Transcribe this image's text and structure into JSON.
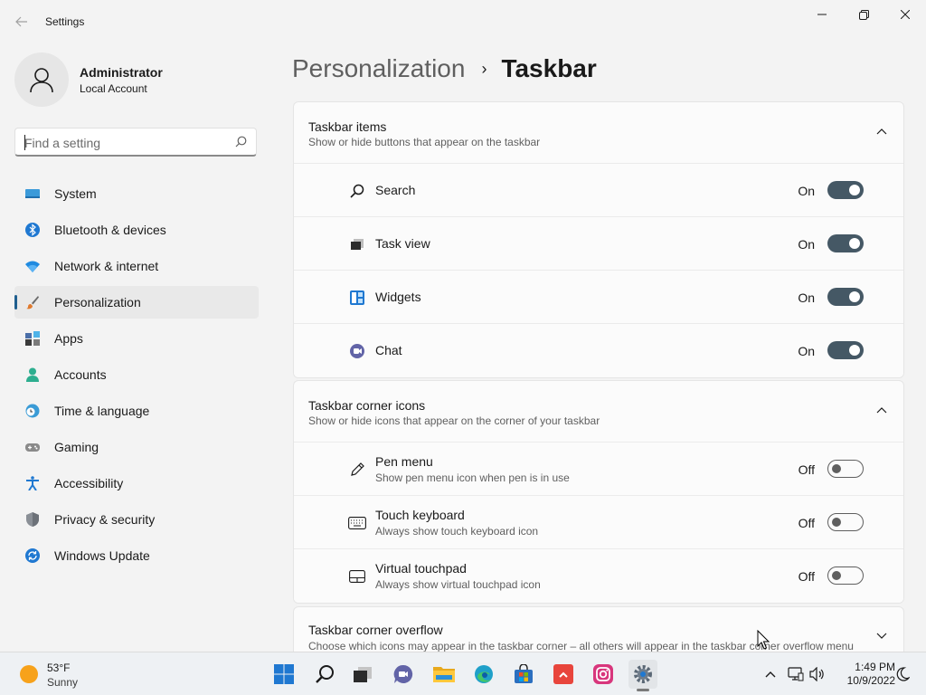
{
  "window": {
    "title": "Settings"
  },
  "profile": {
    "name": "Administrator",
    "account_type": "Local Account"
  },
  "search": {
    "placeholder": "Find a setting",
    "value": ""
  },
  "nav": {
    "items": [
      {
        "label": "System",
        "icon": "monitor-icon",
        "active": false
      },
      {
        "label": "Bluetooth & devices",
        "icon": "bluetooth-icon",
        "active": false
      },
      {
        "label": "Network & internet",
        "icon": "wifi-icon",
        "active": false
      },
      {
        "label": "Personalization",
        "icon": "paintbrush-icon",
        "active": true
      },
      {
        "label": "Apps",
        "icon": "apps-icon",
        "active": false
      },
      {
        "label": "Accounts",
        "icon": "person-icon",
        "active": false
      },
      {
        "label": "Time & language",
        "icon": "globe-clock-icon",
        "active": false
      },
      {
        "label": "Gaming",
        "icon": "gamepad-icon",
        "active": false
      },
      {
        "label": "Accessibility",
        "icon": "accessibility-icon",
        "active": false
      },
      {
        "label": "Privacy & security",
        "icon": "shield-icon",
        "active": false
      },
      {
        "label": "Windows Update",
        "icon": "update-icon",
        "active": false
      }
    ]
  },
  "breadcrumb": {
    "parent": "Personalization",
    "separator": "›",
    "current": "Taskbar"
  },
  "sections": {
    "taskbar_items": {
      "title": "Taskbar items",
      "subtitle": "Show or hide buttons that appear on the taskbar",
      "rows": [
        {
          "label": "Search",
          "state": "On",
          "icon": "search-icon"
        },
        {
          "label": "Task view",
          "state": "On",
          "icon": "task-view-icon"
        },
        {
          "label": "Widgets",
          "state": "On",
          "icon": "widgets-icon"
        },
        {
          "label": "Chat",
          "state": "On",
          "icon": "chat-icon"
        }
      ]
    },
    "corner_icons": {
      "title": "Taskbar corner icons",
      "subtitle": "Show or hide icons that appear on the corner of your taskbar",
      "rows": [
        {
          "label": "Pen menu",
          "description": "Show pen menu icon when pen is in use",
          "state": "Off",
          "icon": "pen-icon"
        },
        {
          "label": "Touch keyboard",
          "description": "Always show touch keyboard icon",
          "state": "Off",
          "icon": "keyboard-icon"
        },
        {
          "label": "Virtual touchpad",
          "description": "Always show virtual touchpad icon",
          "state": "Off",
          "icon": "touchpad-icon"
        }
      ]
    },
    "corner_overflow": {
      "title": "Taskbar corner overflow",
      "subtitle": "Choose which icons may appear in the taskbar corner – all others will appear in the taskbar corner overflow menu"
    }
  },
  "taskbar": {
    "weather": {
      "temp": "53°F",
      "condition": "Sunny"
    },
    "apps": [
      "start-icon",
      "search-icon",
      "task-view-icon",
      "chat-icon",
      "file-explorer-icon",
      "edge-icon",
      "store-icon",
      "app-red-icon",
      "instagram-icon",
      "settings-icon"
    ],
    "clock": {
      "time": "1:49 PM",
      "date": "10/9/2022"
    }
  }
}
